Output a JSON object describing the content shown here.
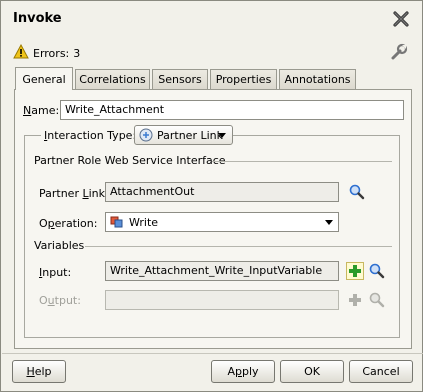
{
  "window": {
    "title": "Invoke"
  },
  "status": {
    "errors_label": "Errors:",
    "errors_count": "3"
  },
  "tabs": [
    {
      "label": "General",
      "active": true
    },
    {
      "label": "Correlations"
    },
    {
      "label": "Sensors"
    },
    {
      "label": "Properties"
    },
    {
      "label": "Annotations"
    }
  ],
  "general": {
    "name_label_prefix": "N",
    "name_label_rest": "ame:",
    "name_value": "Write_Attachment",
    "interaction_label_prefix": "I",
    "interaction_label_rest": "nteraction Type:",
    "interaction_value": "Partner Link",
    "partner_section": "Partner Role Web Service Interface",
    "partner_link_label_a": "Partner ",
    "partner_link_label_u": "L",
    "partner_link_label_b": "ink:",
    "partner_link_value": "AttachmentOut",
    "operation_label_a": "O",
    "operation_label_u": "p",
    "operation_label_b": "eration:",
    "operation_value": "Write",
    "variables_section": "Variables",
    "input_label_u": "I",
    "input_label_rest": "nput:",
    "input_value": "Write_Attachment_Write_InputVariable",
    "output_label_a": "O",
    "output_label_u": "u",
    "output_label_b": "tput:",
    "output_value": ""
  },
  "buttons": {
    "help_u": "H",
    "help_rest": "elp",
    "apply_a": "A",
    "apply_u": "p",
    "apply_b": "ply",
    "ok": "OK",
    "cancel": "Cancel"
  },
  "colors": {
    "accent_icon": "#2e6fd0",
    "add_icon": "#2a9b2a",
    "warning": "#f0c419"
  }
}
